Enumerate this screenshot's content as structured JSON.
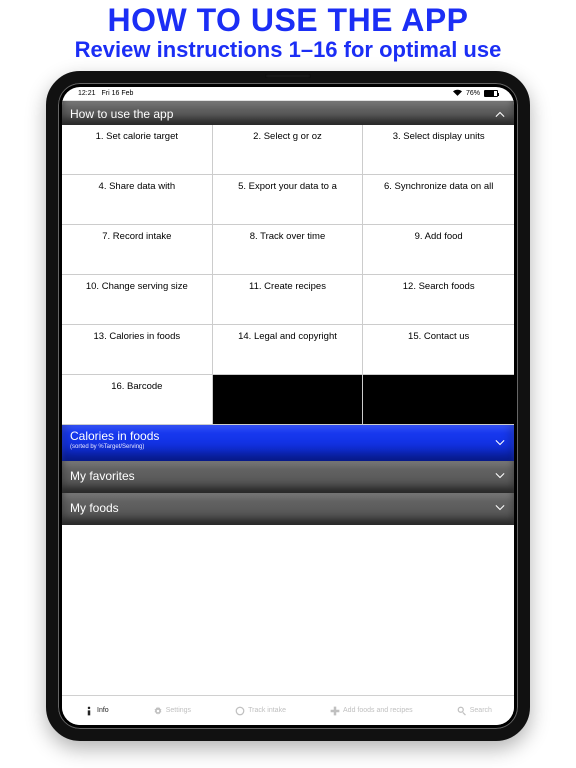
{
  "promo": {
    "title": "HOW TO USE THE APP",
    "subtitle": "Review instructions 1–16 for optimal use"
  },
  "status": {
    "time": "12:21",
    "date": "Fri 16 Feb",
    "battery": "76%"
  },
  "sections": {
    "howto": {
      "title": "How to use the app"
    },
    "calories": {
      "title": "Calories in foods",
      "subtitle": "(sorted by %Target/Serving)"
    },
    "favorites": {
      "title": "My favorites"
    },
    "myfoods": {
      "title": "My foods"
    }
  },
  "grid": {
    "c1": "1. Set calorie target",
    "c2": "2. Select g or oz",
    "c3": "3. Select display units",
    "c4": "4. Share data with",
    "c5": "5. Export your data to a",
    "c6": "6. Synchronize data on all",
    "c7": "7. Record intake",
    "c8": "8. Track over time",
    "c9": "9. Add food",
    "c10": "10. Change serving size",
    "c11": "11. Create recipes",
    "c12": "12. Search foods",
    "c13": "13. Calories in foods",
    "c14": "14. Legal and copyright",
    "c15": "15. Contact us",
    "c16": "16. Barcode"
  },
  "tabs": {
    "info": "Info",
    "settings": "Settings",
    "track": "Track intake",
    "add": "Add foods and recipes",
    "search": "Search"
  }
}
